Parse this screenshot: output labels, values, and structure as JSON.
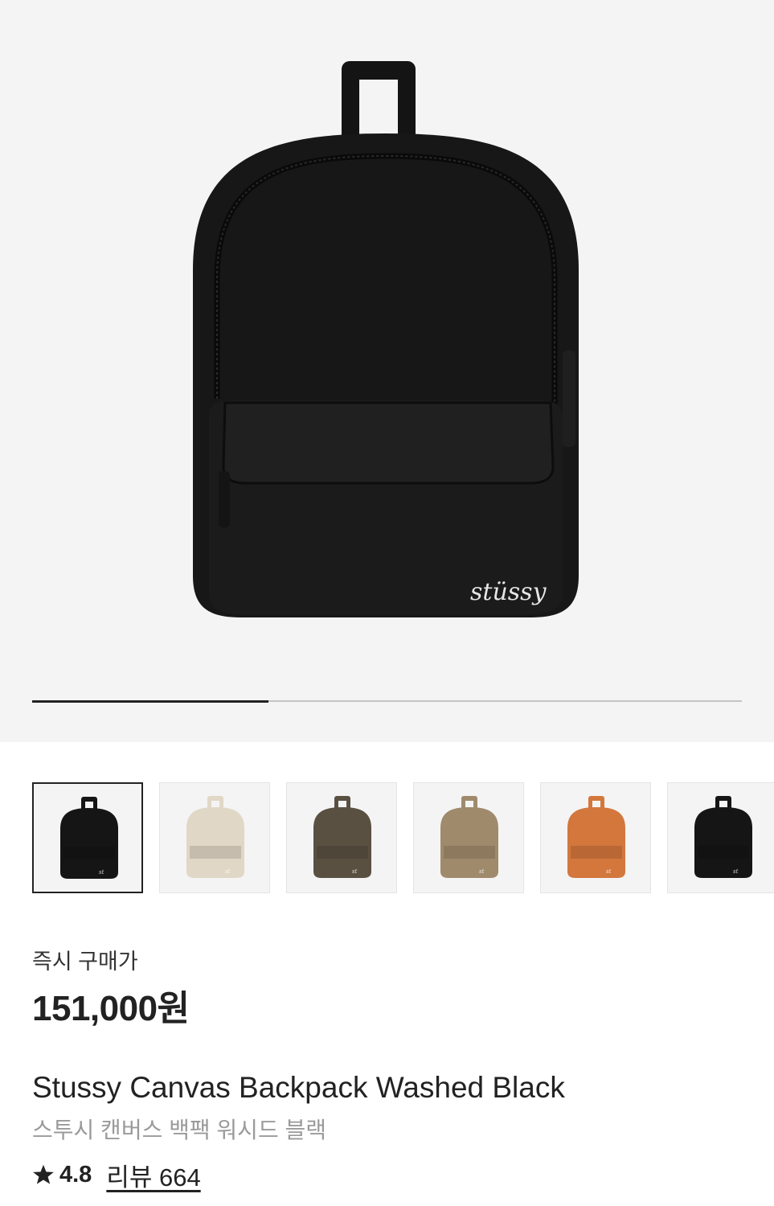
{
  "product_images": {
    "current_index": 1,
    "total": 3,
    "thumbnails": [
      {
        "name": "black",
        "color": "#151515"
      },
      {
        "name": "natural",
        "color": "#e1d7c6"
      },
      {
        "name": "camo-dark",
        "color": "#5a5042"
      },
      {
        "name": "camo-light",
        "color": "#a08a6c"
      },
      {
        "name": "tie-dye",
        "color": "#d3773d"
      },
      {
        "name": "black",
        "color": "#151515"
      }
    ]
  },
  "pricing": {
    "label": "즉시 구매가",
    "price": "151,000원"
  },
  "product": {
    "title_en": "Stussy Canvas Backpack Washed Black",
    "title_ko": "스투시 캔버스 백팩 워시드 블랙"
  },
  "rating": {
    "icon": "star-icon",
    "value": "4.8",
    "review_label": "리뷰 664"
  },
  "colors": {
    "hero_background": "#f4f4f4",
    "text": "#222222",
    "muted_text": "#9a9a9a"
  }
}
